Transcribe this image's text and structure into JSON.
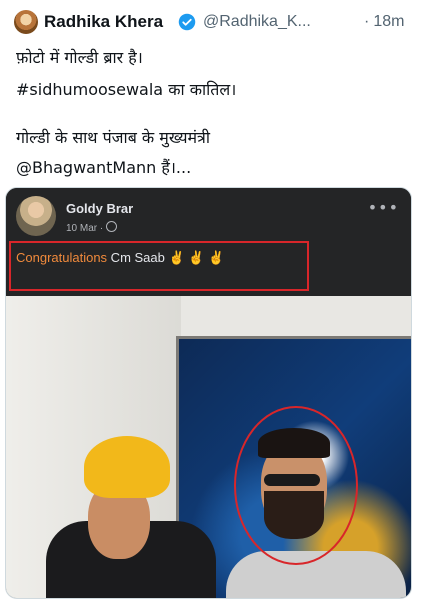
{
  "tweet": {
    "author": {
      "display_name": "Radhika Khera",
      "handle": "@Radhika_K...",
      "verified": true
    },
    "timestamp": "18m",
    "text_lines": [
      "फ़ोटो में गोल्डी ब्रार है।",
      "#sidhumoosewala का कातिल।",
      "",
      "गोल्डी के साथ पंजाब के मुख्यमंत्री",
      "@BhagwantMann हैं।..."
    ]
  },
  "embedded_post": {
    "author_name": "Goldy Brar",
    "date": "10 Mar ·",
    "more_icon": "ellipsis-icon",
    "caption_highlight": "Congratulations",
    "caption_rest": " Cm Saab ✌ ✌ ✌"
  },
  "colors": {
    "verified_blue": "#1d9bf0",
    "highlight_red": "#d8262a",
    "fb_dark": "#242526",
    "caption_orange": "#f08a3c"
  }
}
